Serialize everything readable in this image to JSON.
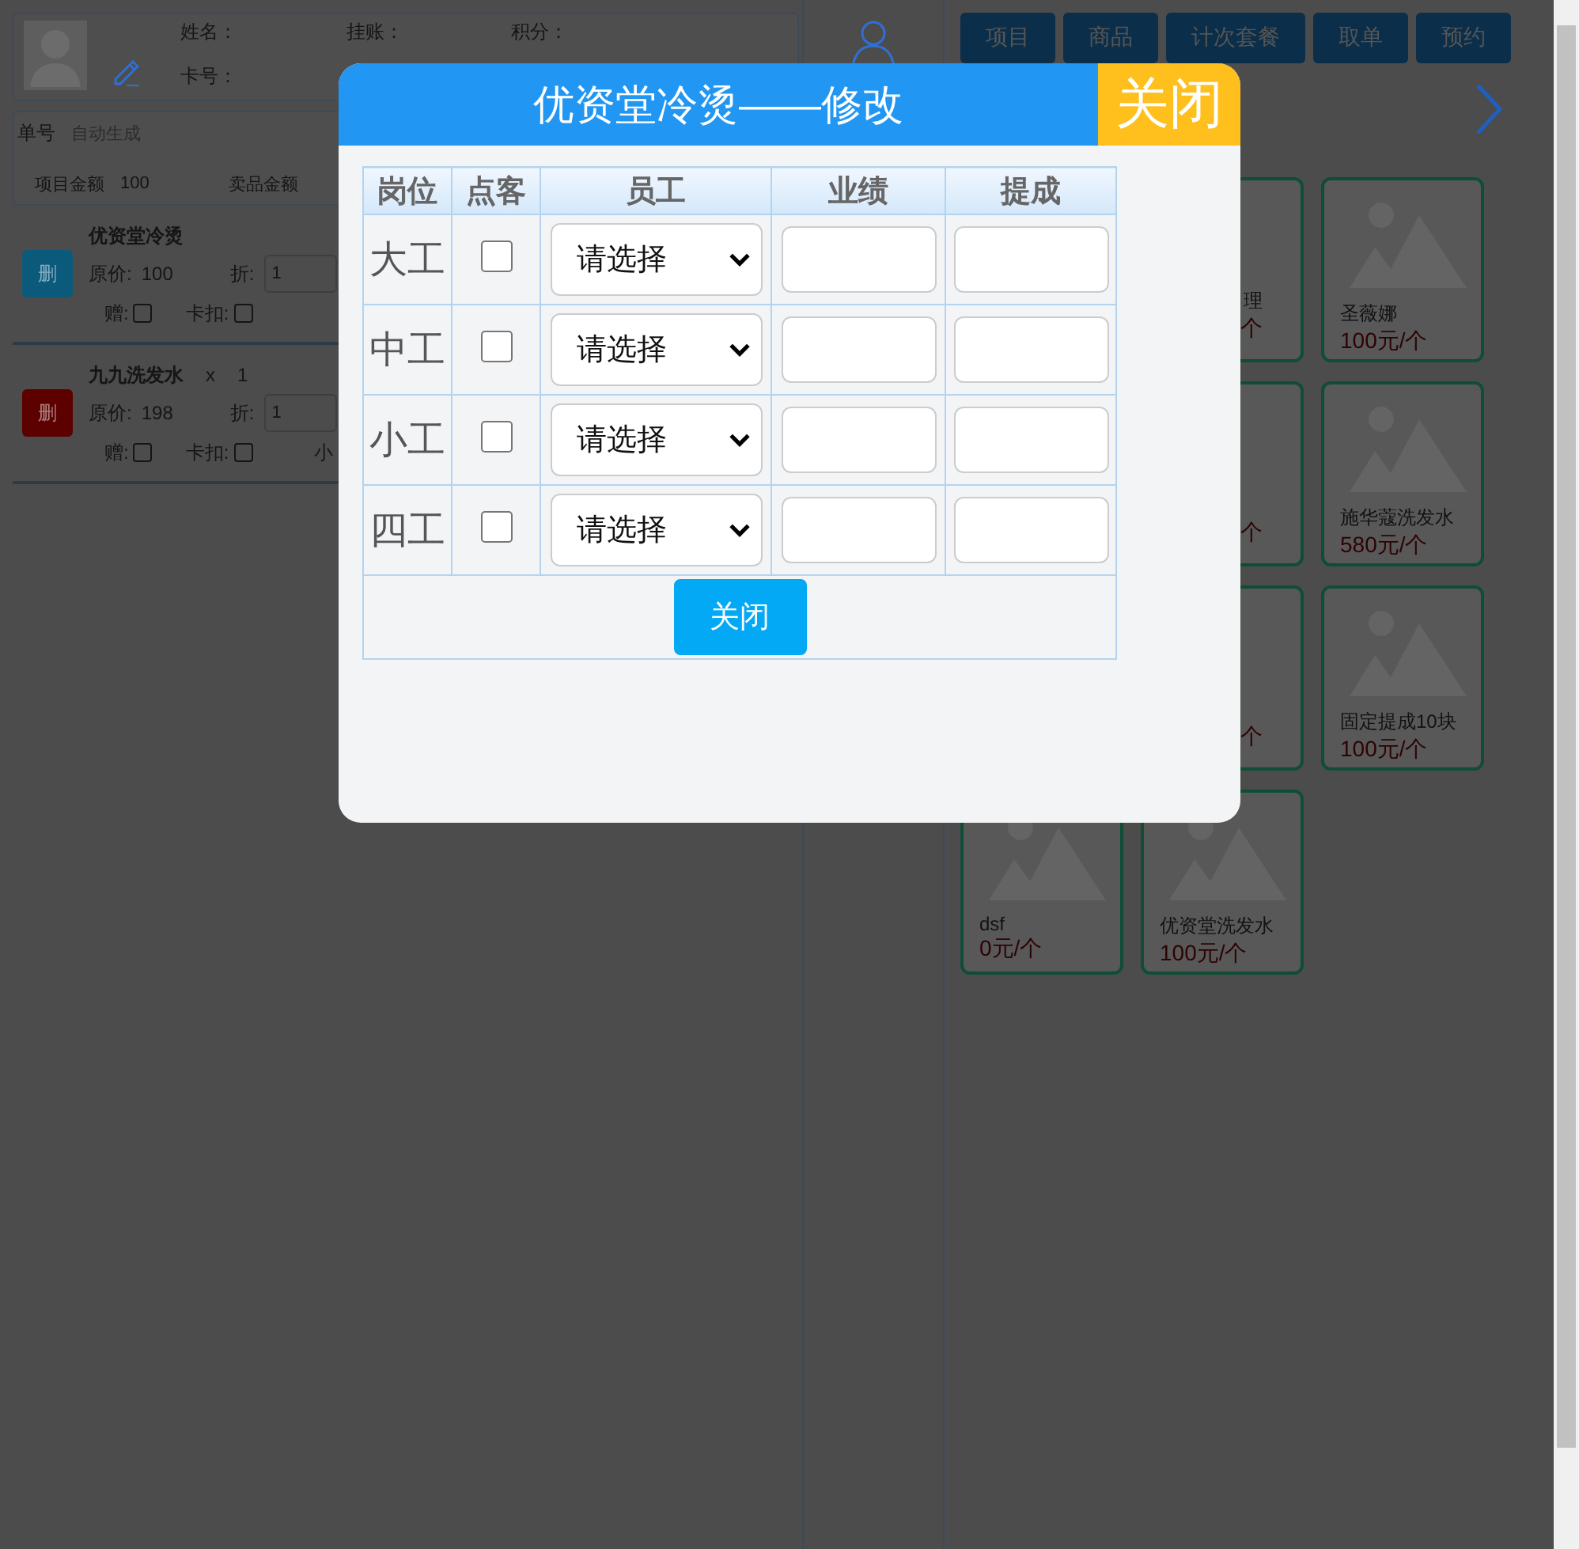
{
  "member": {
    "name_label": "姓名：",
    "credit_label": "挂账：",
    "points_label": "积分：",
    "card_label": "卡号："
  },
  "order": {
    "number_label": "单号",
    "number_value": "自动生成",
    "project_amount_label": "项目金额",
    "project_amount": "100",
    "goods_amount_label": "卖品金额"
  },
  "order_items": [
    {
      "kind": "primary",
      "name": "优资堂冷烫",
      "delete": "删",
      "price_label": "原价:",
      "price": "100",
      "discount_label": "折:",
      "discount": "1",
      "gift_label": "赠:",
      "gift": false,
      "card_deduct_label": "卡扣:",
      "card_deduct": false
    },
    {
      "kind": "danger",
      "name": "九九洗发水",
      "quantity_sign": "x",
      "quantity": "1",
      "delete": "删",
      "price_label": "原价:",
      "price": "198",
      "discount_label": "折:",
      "discount": "1",
      "gift_label": "赠:",
      "gift": false,
      "card_deduct_label": "卡扣:",
      "card_deduct": false,
      "extra": "小"
    }
  ],
  "tabs": [
    "项目",
    "商品",
    "计次套餐",
    "取单",
    "预约"
  ],
  "cards": [
    {
      "kind": "partial",
      "name": "理",
      "price": "个"
    },
    {
      "kind": "full",
      "name": "圣薇娜",
      "price": "100元/个"
    },
    {
      "kind": "partial",
      "price": "个"
    },
    {
      "kind": "full",
      "name": "施华蔻洗发水",
      "price": "580元/个"
    },
    {
      "kind": "partial",
      "price": "个"
    },
    {
      "kind": "full",
      "name": "固定提成10块",
      "price": "100元/个"
    },
    {
      "kind": "full",
      "name": "dsf",
      "price": "0元/个"
    },
    {
      "kind": "full",
      "name": "优资堂洗发水",
      "price": "100元/个"
    }
  ],
  "dialog": {
    "title": "优资堂冷烫——修改",
    "close": "关闭",
    "columns": [
      "岗位",
      "点客",
      "员工",
      "业绩",
      "提成"
    ],
    "rows": [
      {
        "position": "大工",
        "checked": false,
        "employee": "请选择"
      },
      {
        "position": "中工",
        "checked": false,
        "employee": "请选择"
      },
      {
        "position": "小工",
        "checked": false,
        "employee": "请选择"
      },
      {
        "position": "四工",
        "checked": false,
        "employee": "请选择"
      }
    ],
    "footer_button": "关闭"
  }
}
